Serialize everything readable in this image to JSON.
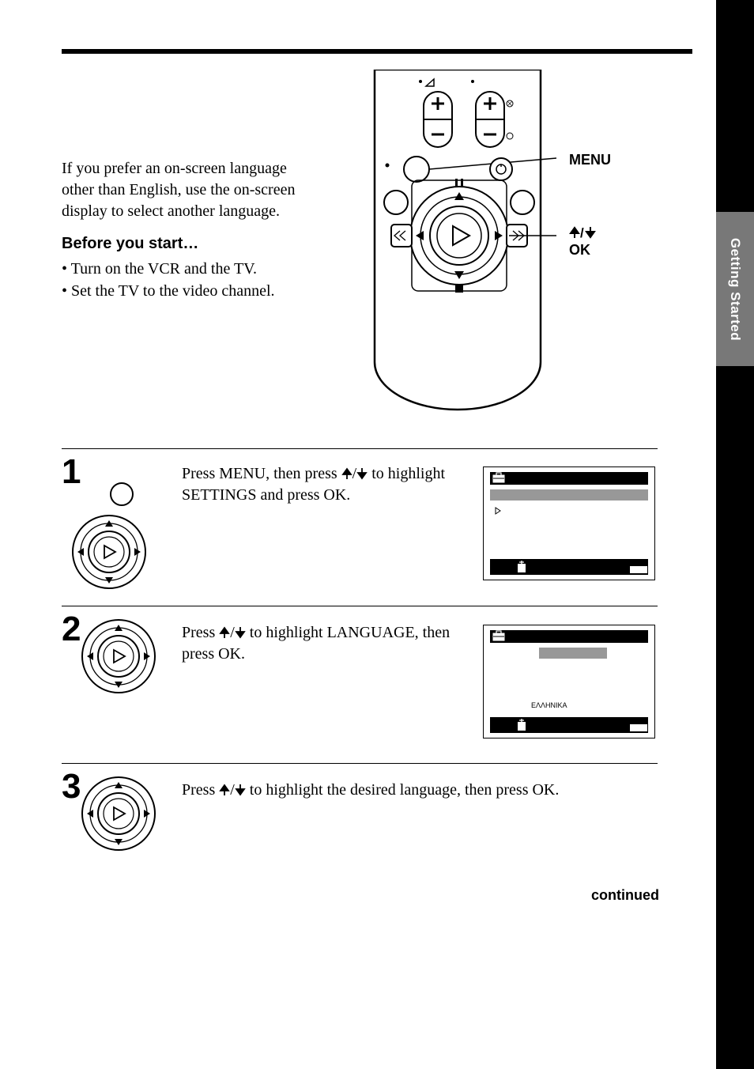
{
  "side_tab": "Getting Started",
  "intro": "If you prefer an on-screen language other than English, use the on-screen display to select another language.",
  "before": {
    "title": "Before you start…",
    "items": [
      "• Turn on the VCR and the TV.",
      "• Set the TV to the video channel."
    ]
  },
  "remote_labels": {
    "menu": "MENU",
    "ok_top": "/",
    "ok_bottom": "OK"
  },
  "steps": {
    "s1": {
      "num": "1",
      "text_a": "Press MENU, then press ",
      "text_b": " to highlight SETTINGS and press OK."
    },
    "s2": {
      "num": "2",
      "text_a": "Press ",
      "text_b": " to highlight LANGUAGE, then press OK."
    },
    "s3": {
      "num": "3",
      "text_a": "Press ",
      "text_b": " to highlight the desired language, then press OK."
    }
  },
  "osd2_greek": "EΛΛHNIKA",
  "continued": "continued"
}
